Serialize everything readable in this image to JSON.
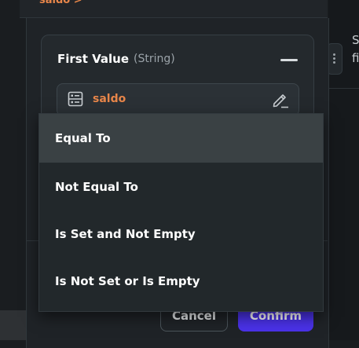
{
  "breadcrumb": {
    "label": "saldo >"
  },
  "background": {
    "text_line1": "S",
    "text_line2": "fi"
  },
  "first_value": {
    "title": "First Value",
    "type": "(String)",
    "field_value": "saldo"
  },
  "dropdown": {
    "options": [
      {
        "label": "Equal To",
        "highlighted": true
      },
      {
        "label": "Not Equal To",
        "highlighted": false
      },
      {
        "label": "Is Set and Not Empty",
        "highlighted": false
      },
      {
        "label": "Is Not Set or Is Empty",
        "highlighted": false
      }
    ]
  },
  "footer": {
    "cancel_label": "Cancel",
    "confirm_label": "Confirm"
  },
  "colors": {
    "accent": "#4a32e8",
    "variable": "#e8864a",
    "highlight": "#3a4144"
  }
}
